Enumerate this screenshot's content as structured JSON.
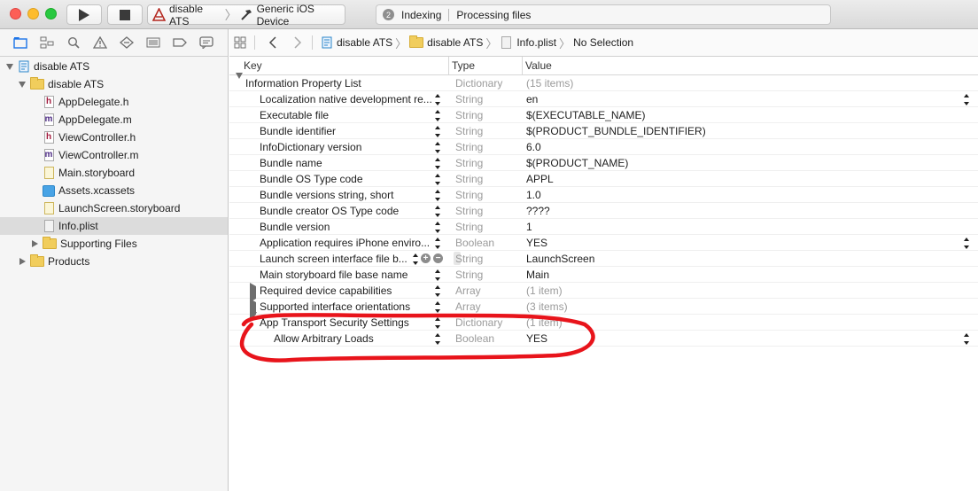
{
  "toolbar": {
    "scheme_name": "disable ATS",
    "device_name": "Generic iOS Device",
    "activity_count": "2",
    "activity_title": "Indexing",
    "activity_detail": "Processing files"
  },
  "navigator": {
    "tree": [
      {
        "label": "disable ATS",
        "kind": "project",
        "indent": 0,
        "disclosure": "open"
      },
      {
        "label": "disable ATS",
        "kind": "folder",
        "indent": 1,
        "disclosure": "open"
      },
      {
        "label": "AppDelegate.h",
        "kind": "h",
        "indent": 2
      },
      {
        "label": "AppDelegate.m",
        "kind": "m",
        "indent": 2
      },
      {
        "label": "ViewController.h",
        "kind": "h",
        "indent": 2
      },
      {
        "label": "ViewController.m",
        "kind": "m",
        "indent": 2
      },
      {
        "label": "Main.storyboard",
        "kind": "storyboard",
        "indent": 2
      },
      {
        "label": "Assets.xcassets",
        "kind": "xcassets",
        "indent": 2
      },
      {
        "label": "LaunchScreen.storyboard",
        "kind": "storyboard",
        "indent": 2
      },
      {
        "label": "Info.plist",
        "kind": "plist",
        "indent": 2,
        "selected": true
      },
      {
        "label": "Supporting Files",
        "kind": "folder",
        "indent": 2,
        "disclosure": "closed"
      },
      {
        "label": "Products",
        "kind": "folder",
        "indent": 1,
        "disclosure": "closed"
      }
    ]
  },
  "jumpbar": {
    "crumbs": [
      "disable ATS",
      "disable ATS",
      "Info.plist",
      "No Selection"
    ]
  },
  "plist": {
    "headers": {
      "key": "Key",
      "type": "Type",
      "value": "Value"
    },
    "rows": [
      {
        "key": "Information Property List",
        "type": "Dictionary",
        "value": "(15 items)",
        "level": 0,
        "disclosure": "open",
        "meta": true
      },
      {
        "key": "Localization native development re...",
        "type": "String",
        "value": "en",
        "level": 1,
        "value_stepper": true
      },
      {
        "key": "Executable file",
        "type": "String",
        "value": "$(EXECUTABLE_NAME)",
        "level": 1
      },
      {
        "key": "Bundle identifier",
        "type": "String",
        "value": "$(PRODUCT_BUNDLE_IDENTIFIER)",
        "level": 1
      },
      {
        "key": "InfoDictionary version",
        "type": "String",
        "value": "6.0",
        "level": 1
      },
      {
        "key": "Bundle name",
        "type": "String",
        "value": "$(PRODUCT_NAME)",
        "level": 1
      },
      {
        "key": "Bundle OS Type code",
        "type": "String",
        "value": "APPL",
        "level": 1
      },
      {
        "key": "Bundle versions string, short",
        "type": "String",
        "value": "1.0",
        "level": 1
      },
      {
        "key": "Bundle creator OS Type code",
        "type": "String",
        "value": "????",
        "level": 1
      },
      {
        "key": "Bundle version",
        "type": "String",
        "value": "1",
        "level": 1
      },
      {
        "key": "Application requires iPhone enviro...",
        "type": "Boolean",
        "value": "YES",
        "level": 1,
        "value_stepper": true
      },
      {
        "key": "Launch screen interface file b...",
        "type": "String",
        "value": "LaunchScreen",
        "level": 1,
        "hover": true
      },
      {
        "key": "Main storyboard file base name",
        "type": "String",
        "value": "Main",
        "level": 1
      },
      {
        "key": "Required device capabilities",
        "type": "Array",
        "value": "(1 item)",
        "level": 1,
        "disclosure": "closed",
        "meta": true
      },
      {
        "key": "Supported interface orientations",
        "type": "Array",
        "value": "(3 items)",
        "level": 1,
        "disclosure": "closed",
        "meta": true
      },
      {
        "key": "App Transport Security Settings",
        "type": "Dictionary",
        "value": "(1 item)",
        "level": 1,
        "disclosure": "open",
        "meta": true
      },
      {
        "key": "Allow Arbitrary Loads",
        "type": "Boolean",
        "value": "YES",
        "level": 2,
        "value_stepper": true
      }
    ]
  },
  "annotation": {
    "color": "#e8141b"
  }
}
